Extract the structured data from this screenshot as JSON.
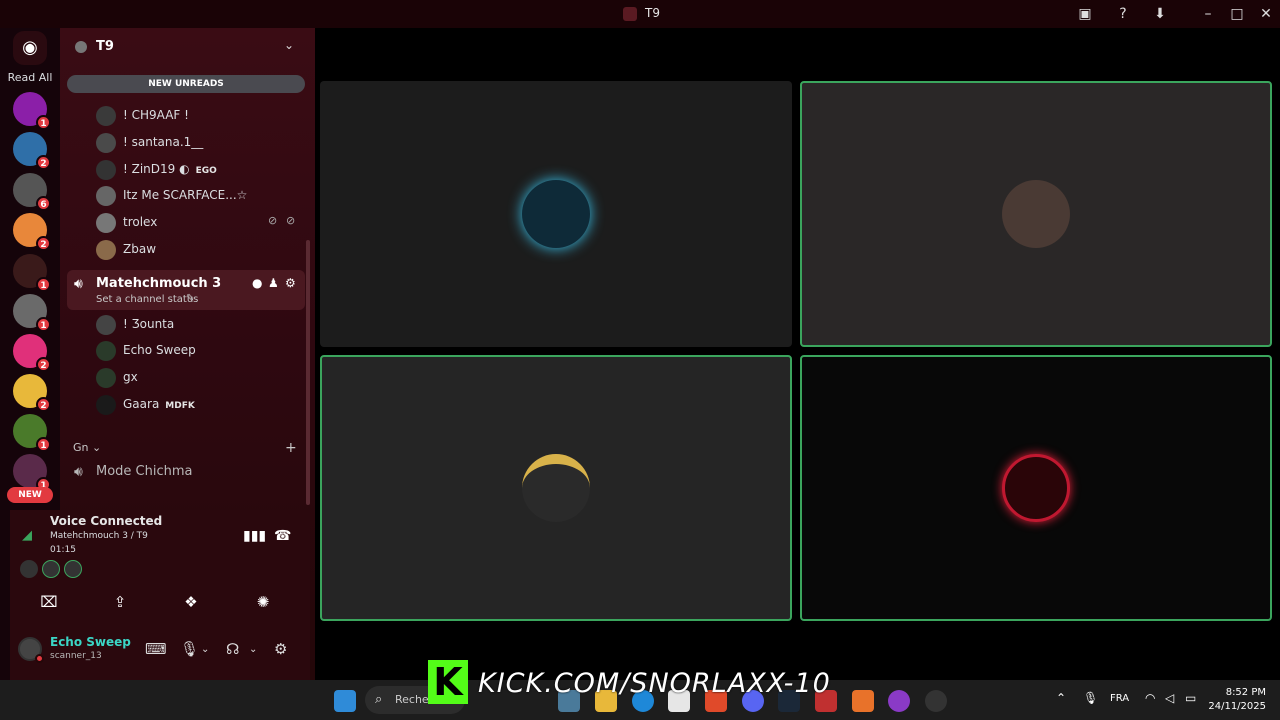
{
  "titlebar": {
    "title": "T9"
  },
  "rail": {
    "read_all": "Read All",
    "new_label": "NEW",
    "servers": [
      {
        "badge": "1",
        "color": "#8b1fa8"
      },
      {
        "badge": "2",
        "color": "#2f6fa8"
      },
      {
        "badge": "6",
        "color": "#555555"
      },
      {
        "badge": "2",
        "color": "#e8873a"
      },
      {
        "badge": "1",
        "color": "#3a1a1a"
      },
      {
        "badge": "1",
        "color": "#6a6a6a"
      },
      {
        "badge": "2",
        "color": "#e0307a"
      },
      {
        "badge": "2",
        "color": "#e8b83a"
      },
      {
        "badge": "1",
        "color": "#4a7a2a"
      },
      {
        "badge": "1",
        "color": "#5a2a4a"
      }
    ]
  },
  "sidebar": {
    "server_name": "T9",
    "new_unreads": "NEW UNREADS",
    "members_top": [
      {
        "name": "! CH9AAF !",
        "tag": ""
      },
      {
        "name": "! santana.1__",
        "tag": ""
      },
      {
        "name": "! ZinD19 ◐",
        "tag": "EGO"
      },
      {
        "name": "Itz Me SCARFACE...☆",
        "tag": ""
      },
      {
        "name": "trolex",
        "tag": ""
      },
      {
        "name": "Zbaw",
        "tag": ""
      }
    ],
    "channel": {
      "name": "Matehchmouch 3",
      "status": "Set a channel status"
    },
    "members_channel": [
      {
        "name": "! Ʒounta",
        "tag": ""
      },
      {
        "name": "Echo Sweep",
        "tag": ""
      },
      {
        "name": "gx",
        "tag": ""
      },
      {
        "name": "Gaara",
        "tag": "MDFK"
      }
    ],
    "category": "Gn",
    "channel2": "Mode Chichma"
  },
  "voice": {
    "title": "Voice Connected",
    "sub": "Matehchmouch 3 / T9",
    "timer": "01:15"
  },
  "user": {
    "name": "Echo Sweep",
    "sub": "scanner_13"
  },
  "taskbar": {
    "search_placeholder": "Rechercher",
    "kick_text": "KICK.COM/SNORLAXX-10",
    "kick_logo": "K",
    "lang": "FRA",
    "time": "8:52 PM",
    "date": "24/11/2025"
  },
  "colors": {
    "speaking": "#3ba55d",
    "badge": "#e23a40",
    "kick": "#53fc18"
  }
}
